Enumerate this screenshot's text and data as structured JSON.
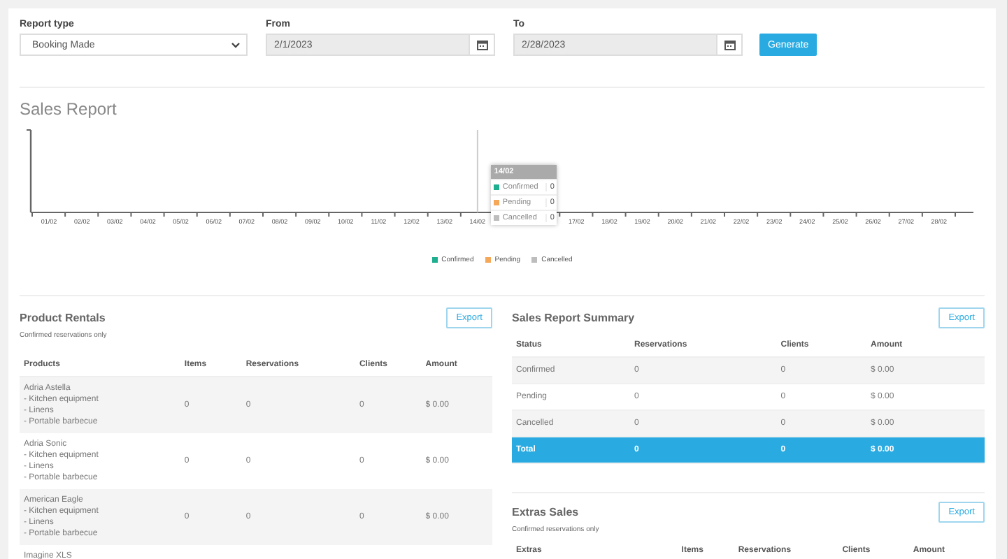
{
  "filters": {
    "report_type": {
      "label": "Report type",
      "value": "Booking Made"
    },
    "from": {
      "label": "From",
      "value": "2/1/2023"
    },
    "to": {
      "label": "To",
      "value": "2/28/2023"
    },
    "button": "Generate"
  },
  "sales_report": {
    "title": "Sales Report",
    "x_labels_before_tooltip": [
      "01/02",
      "02/02",
      "03/02",
      "04/02",
      "05/02",
      "06/02",
      "07/02",
      "08/02",
      "09/02",
      "10/02",
      "11/02",
      "12/02",
      "13/02",
      "14/02"
    ],
    "x_labels_after_tooltip": [
      "17/02",
      "18/02",
      "19/02",
      "20/02",
      "21/02",
      "22/02",
      "23/02",
      "24/02",
      "25/02",
      "26/02",
      "27/02",
      "28/02"
    ],
    "tooltip": {
      "title": "14/02",
      "rows": [
        {
          "name": "Confirmed",
          "value": "0",
          "color": "#1fae8f"
        },
        {
          "name": "Pending",
          "value": "0",
          "color": "#f5a85a"
        },
        {
          "name": "Cancelled",
          "value": "0",
          "color": "#bdbdbd"
        }
      ]
    },
    "legend": [
      {
        "label": "Confirmed",
        "color": "#1fae8f"
      },
      {
        "label": "Pending",
        "color": "#f5a85a"
      },
      {
        "label": "Cancelled",
        "color": "#bdbdbd"
      }
    ]
  },
  "product_rentals": {
    "title": "Product Rentals",
    "subtitle": "Confirmed reservations only",
    "export": "Export",
    "columns": [
      "Products",
      "Items",
      "Reservations",
      "Clients",
      "Amount"
    ],
    "rows": [
      {
        "lines": [
          "Adria Astella",
          "- Kitchen equipment",
          "- Linens",
          "- Portable barbecue"
        ],
        "items": "0",
        "reservations": "0",
        "clients": "0",
        "amount": "$ 0.00"
      },
      {
        "lines": [
          "Adria Sonic",
          "- Kitchen equipment",
          "- Linens",
          "- Portable barbecue"
        ],
        "items": "0",
        "reservations": "0",
        "clients": "0",
        "amount": "$ 0.00"
      },
      {
        "lines": [
          "American Eagle",
          "- Kitchen equipment",
          "- Linens",
          "- Portable barbecue"
        ],
        "items": "0",
        "reservations": "0",
        "clients": "0",
        "amount": "$ 0.00"
      },
      {
        "lines": [
          "Imagine XLS"
        ]
      }
    ]
  },
  "summary": {
    "title": "Sales Report Summary",
    "export": "Export",
    "columns": [
      "Status",
      "Reservations",
      "Clients",
      "Amount"
    ],
    "rows": [
      {
        "kind": "status",
        "cells": [
          "Confirmed",
          "0",
          "0",
          "$ 0.00"
        ]
      },
      {
        "kind": "status",
        "cells": [
          "Pending",
          "0",
          "0",
          "$ 0.00"
        ]
      },
      {
        "kind": "status",
        "cells": [
          "Cancelled",
          "0",
          "0",
          "$ 0.00"
        ]
      },
      {
        "kind": "total",
        "cells": [
          "Total",
          "0",
          "0",
          "$ 0.00"
        ]
      }
    ]
  },
  "extras_sales": {
    "title": "Extras Sales",
    "subtitle": "Confirmed reservations only",
    "export": "Export",
    "columns": [
      "Extras",
      "Items",
      "Reservations",
      "Clients",
      "Amount"
    ]
  }
}
